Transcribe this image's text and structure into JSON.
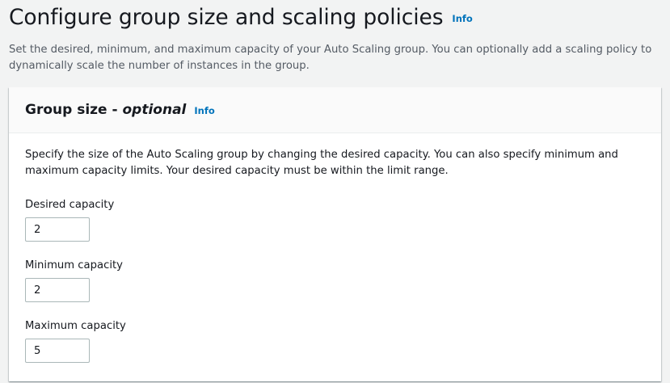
{
  "page": {
    "title": "Configure group size and scaling policies",
    "info_label": "Info",
    "description": "Set the desired, minimum, and maximum capacity of your Auto Scaling group. You can optionally add a scaling policy to dynamically scale the number of instances in the group."
  },
  "group_size": {
    "title": "Group size",
    "separator": " - ",
    "optional_label": "optional",
    "info_label": "Info",
    "description": "Specify the size of the Auto Scaling group by changing the desired capacity. You can also specify minimum and maximum capacity limits. Your desired capacity must be within the limit range.",
    "desired_capacity": {
      "label": "Desired capacity",
      "value": "2"
    },
    "minimum_capacity": {
      "label": "Minimum capacity",
      "value": "2"
    },
    "maximum_capacity": {
      "label": "Maximum capacity",
      "value": "5"
    }
  },
  "colors": {
    "link": "#0073bb",
    "background": "#f2f3f3",
    "panel_header": "#fafafa",
    "text": "#16191f",
    "secondary_text": "#545b64",
    "input_border": "#aab7b8"
  }
}
